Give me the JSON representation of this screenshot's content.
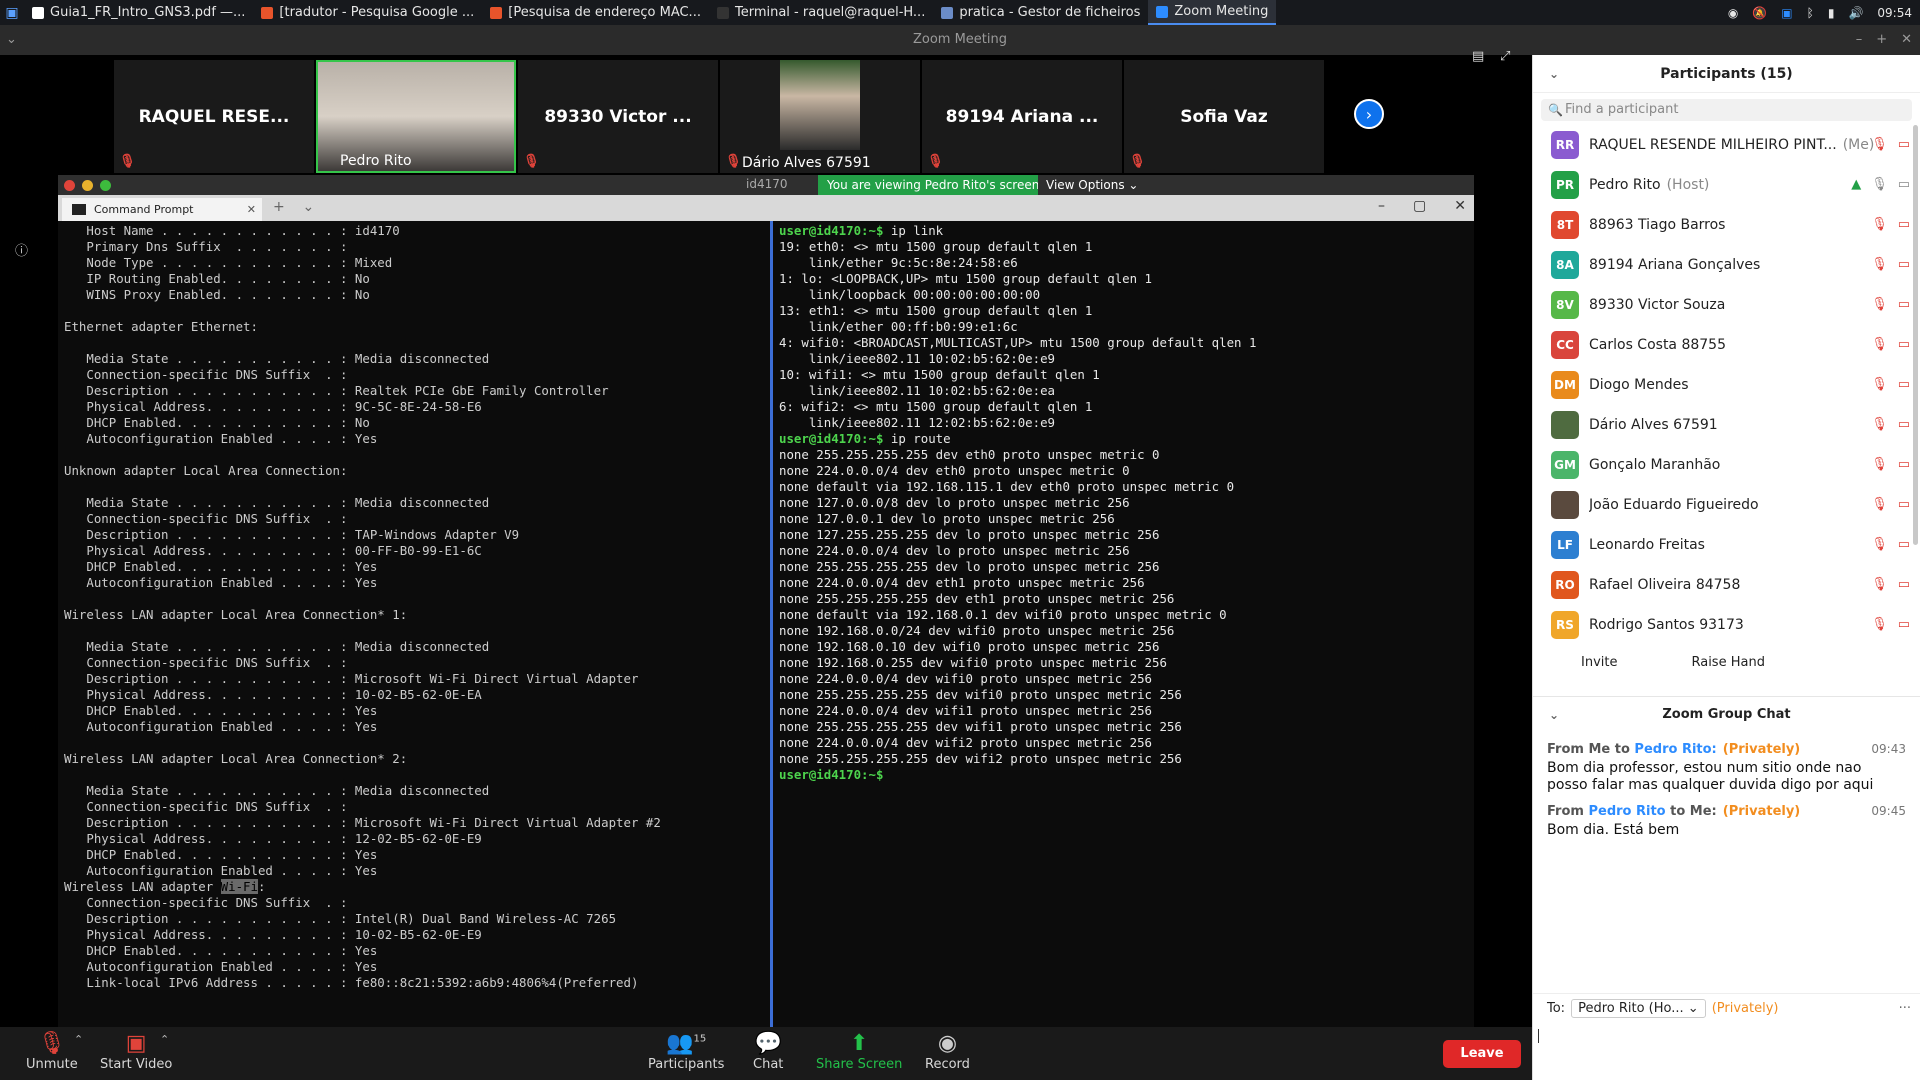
{
  "taskbar": {
    "tasks": [
      {
        "label": "Guia1_FR_Intro_GNS3.pdf —...",
        "color": "#ffffff"
      },
      {
        "label": "[tradutor - Pesquisa Google ...",
        "color": "#e8542b"
      },
      {
        "label": "[Pesquisa de endereço MAC...",
        "color": "#e8542b"
      },
      {
        "label": "Terminal - raquel@raquel-H...",
        "color": "#333333"
      },
      {
        "label": "pratica - Gestor de ficheiros",
        "color": "#6b8cc7"
      },
      {
        "label": "Zoom Meeting",
        "color": "#2d8cff"
      }
    ],
    "clock": "09:54"
  },
  "window": {
    "title": "Zoom Meeting"
  },
  "video_tiles": [
    {
      "name": "RAQUEL RESE...",
      "muted": true
    },
    {
      "name": "Pedro Rito",
      "muted": false,
      "active": true
    },
    {
      "name": "89330 Victor ...",
      "muted": true
    },
    {
      "name": "Dário Alves 67591",
      "muted": true
    },
    {
      "name": "89194 Ariana ...",
      "muted": true
    },
    {
      "name": "Sofia Vaz",
      "muted": true
    }
  ],
  "share": {
    "host_label": "id4170",
    "viewing_label": "You are viewing Pedro Rito's screen",
    "view_options_label": "View Options",
    "tab_title": "Command Prompt"
  },
  "left_terminal": "   Host Name . . . . . . . . . . . . : id4170\n   Primary Dns Suffix  . . . . . . . : \n   Node Type . . . . . . . . . . . . : Mixed\n   IP Routing Enabled. . . . . . . . : No\n   WINS Proxy Enabled. . . . . . . . : No\n\nEthernet adapter Ethernet:\n\n   Media State . . . . . . . . . . . : Media disconnected\n   Connection-specific DNS Suffix  . : \n   Description . . . . . . . . . . . : Realtek PCIe GbE Family Controller\n   Physical Address. . . . . . . . . : 9C-5C-8E-24-58-E6\n   DHCP Enabled. . . . . . . . . . . : No\n   Autoconfiguration Enabled . . . . : Yes\n\nUnknown adapter Local Area Connection:\n\n   Media State . . . . . . . . . . . : Media disconnected\n   Connection-specific DNS Suffix  . : \n   Description . . . . . . . . . . . : TAP-Windows Adapter V9\n   Physical Address. . . . . . . . . : 00-FF-B0-99-E1-6C\n   DHCP Enabled. . . . . . . . . . . : Yes\n   Autoconfiguration Enabled . . . . : Yes\n\nWireless LAN adapter Local Area Connection* 1:\n\n   Media State . . . . . . . . . . . : Media disconnected\n   Connection-specific DNS Suffix  . : \n   Description . . . . . . . . . . . : Microsoft Wi-Fi Direct Virtual Adapter\n   Physical Address. . . . . . . . . : 10-02-B5-62-0E-EA\n   DHCP Enabled. . . . . . . . . . . : Yes\n   Autoconfiguration Enabled . . . . : Yes\n\nWireless LAN adapter Local Area Connection* 2:\n\n   Media State . . . . . . . . . . . : Media disconnected\n   Connection-specific DNS Suffix  . : \n   Description . . . . . . . . . . . : Microsoft Wi-Fi Direct Virtual Adapter #2\n   Physical Address. . . . . . . . . : 12-02-B5-62-0E-E9\n   DHCP Enabled. . . . . . . . . . . : Yes\n   Autoconfiguration Enabled . . . . : Yes\n",
  "left_terminal_tail": {
    "heading_prefix": "Wireless LAN adapter ",
    "heading_highlight": "Wi-Fi",
    "heading_suffix": ":",
    "lines": "\n   Connection-specific DNS Suffix  . : \n   Description . . . . . . . . . . . : Intel(R) Dual Band Wireless-AC 7265\n   Physical Address. . . . . . . . . : 10-02-B5-62-0E-E9\n   DHCP Enabled. . . . . . . . . . . : Yes\n   Autoconfiguration Enabled . . . . : Yes\n   Link-local IPv6 Address . . . . . : fe80::8c21:5392:a6b9:4806%4(Preferred)"
  },
  "right_terminal": {
    "prompt": "user@id4170:~$",
    "cmd1": " ip link",
    "out1": "19: eth0: <> mtu 1500 group default qlen 1\n    link/ether 9c:5c:8e:24:58:e6\n1: lo: <LOOPBACK,UP> mtu 1500 group default qlen 1\n    link/loopback 00:00:00:00:00:00\n13: eth1: <> mtu 1500 group default qlen 1\n    link/ether 00:ff:b0:99:e1:6c\n4: wifi0: <BROADCAST,MULTICAST,UP> mtu 1500 group default qlen 1\n    link/ieee802.11 10:02:b5:62:0e:e9\n10: wifi1: <> mtu 1500 group default qlen 1\n    link/ieee802.11 10:02:b5:62:0e:ea\n6: wifi2: <> mtu 1500 group default qlen 1\n    link/ieee802.11 12:02:b5:62:0e:e9",
    "cmd2": " ip route",
    "out2": "none 255.255.255.255 dev eth0 proto unspec metric 0\nnone 224.0.0.0/4 dev eth0 proto unspec metric 0\nnone default via 192.168.115.1 dev eth0 proto unspec metric 0\nnone 127.0.0.0/8 dev lo proto unspec metric 256\nnone 127.0.0.1 dev lo proto unspec metric 256\nnone 127.255.255.255 dev lo proto unspec metric 256\nnone 224.0.0.0/4 dev lo proto unspec metric 256\nnone 255.255.255.255 dev lo proto unspec metric 256\nnone 224.0.0.0/4 dev eth1 proto unspec metric 256\nnone 255.255.255.255 dev eth1 proto unspec metric 256\nnone default via 192.168.0.1 dev wifi0 proto unspec metric 0\nnone 192.168.0.0/24 dev wifi0 proto unspec metric 256\nnone 192.168.0.10 dev wifi0 proto unspec metric 256\nnone 192.168.0.255 dev wifi0 proto unspec metric 256\nnone 224.0.0.0/4 dev wifi0 proto unspec metric 256\nnone 255.255.255.255 dev wifi0 proto unspec metric 256\nnone 224.0.0.0/4 dev wifi1 proto unspec metric 256\nnone 255.255.255.255 dev wifi1 proto unspec metric 256\nnone 224.0.0.0/4 dev wifi2 proto unspec metric 256\nnone 255.255.255.255 dev wifi2 proto unspec metric 256"
  },
  "toolbar": {
    "unmute": "Unmute",
    "start_video": "Start Video",
    "participants": "Participants",
    "participants_count": "15",
    "chat": "Chat",
    "share_screen": "Share Screen",
    "record": "Record",
    "leave": "Leave"
  },
  "participants": {
    "title": "Participants (15)",
    "search_placeholder": "Find a participant",
    "list": [
      {
        "initials": "RR",
        "name": "RAQUEL RESENDE MILHEIRO PINT...",
        "suffix": "(Me)",
        "color": "#8a5bd0"
      },
      {
        "initials": "PR",
        "name": "Pedro Rito",
        "suffix": "(Host)",
        "color": "#23a047"
      },
      {
        "initials": "8T",
        "name": "88963 Tiago Barros",
        "suffix": "",
        "color": "#e0482f"
      },
      {
        "initials": "8A",
        "name": "89194 Ariana Gonçalves",
        "suffix": "",
        "color": "#1fa89a"
      },
      {
        "initials": "8V",
        "name": "89330 Victor Souza",
        "suffix": "",
        "color": "#56b848"
      },
      {
        "initials": "CC",
        "name": "Carlos Costa 88755",
        "suffix": "",
        "color": "#d9453c"
      },
      {
        "initials": "DM",
        "name": "Diogo Mendes",
        "suffix": "",
        "color": "#e98a1c"
      },
      {
        "initials": "",
        "name": "Dário Alves 67591",
        "suffix": "",
        "color": "#4f6b40"
      },
      {
        "initials": "GM",
        "name": "Gonçalo Maranhão",
        "suffix": "",
        "color": "#4bb56a"
      },
      {
        "initials": "",
        "name": "João Eduardo Figueiredo",
        "suffix": "",
        "color": "#5a4a3e"
      },
      {
        "initials": "LF",
        "name": "Leonardo Freitas",
        "suffix": "",
        "color": "#2d7fd1"
      },
      {
        "initials": "RO",
        "name": "Rafael Oliveira 84758",
        "suffix": "",
        "color": "#e0571e"
      },
      {
        "initials": "RS",
        "name": "Rodrigo Santos 93173",
        "suffix": "",
        "color": "#f0a62a"
      }
    ],
    "invite_label": "Invite",
    "raise_hand_label": "Raise Hand"
  },
  "chat": {
    "title": "Zoom Group Chat",
    "messages": [
      {
        "from": "From Me to ",
        "who": "Pedro Rito:",
        "private": "(Privately)",
        "time": "09:43",
        "body": "Bom dia professor, estou num sitio onde nao posso falar mas qualquer duvida digo por aqui"
      },
      {
        "from": "From ",
        "who": "Pedro Rito",
        "to": " to Me:",
        "private": "(Privately)",
        "time": "09:45",
        "body": "Bom dia. Está bem"
      }
    ],
    "to_label": "To:",
    "to_value": "Pedro Rito (Ho...",
    "to_private": "(Privately)"
  }
}
